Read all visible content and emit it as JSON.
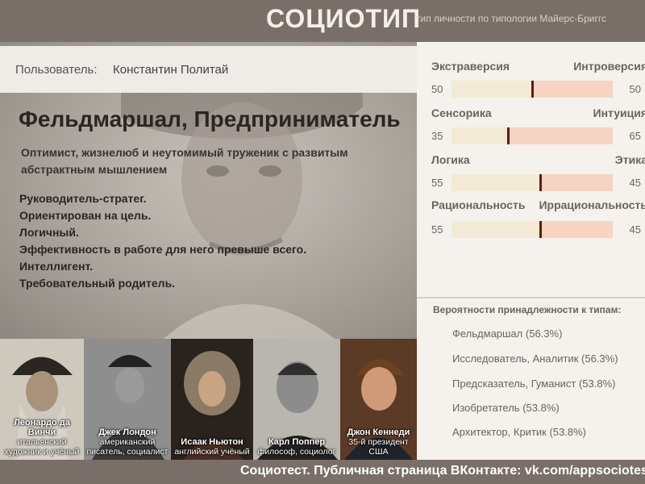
{
  "header": {
    "title": "СОЦИОТИП",
    "subtitle": "тип личности по типологии Майерс-Бриггс"
  },
  "user": {
    "label": "Пользователь:",
    "name": "Константин Политай"
  },
  "type": {
    "title": "Фельдмаршал, Предприниматель",
    "description": "Оптимист, жизнелюб и неутомимый труженик с развитым абстрактным мышлением",
    "traits": [
      "Руководитель-стратег.",
      "Ориентирован на цель.",
      "Логичный.",
      "Эффективность в работе для него превыше всего.",
      "Интеллигент.",
      "Требовательный родитель."
    ]
  },
  "scales": [
    {
      "left": "Экстраверсия",
      "right": "Интроверсия",
      "left_value": "50",
      "right_value": "50",
      "left_pct": 50
    },
    {
      "left": "Сенсорика",
      "right": "Интуиция",
      "left_value": "35",
      "right_value": "65",
      "left_pct": 35
    },
    {
      "left": "Логика",
      "right": "Этика",
      "left_value": "55",
      "right_value": "45",
      "left_pct": 55
    },
    {
      "left": "Рациональность",
      "right": "Иррациональность",
      "left_value": "55",
      "right_value": "45",
      "left_pct": 55
    }
  ],
  "probabilities": {
    "title": "Вероятности принадлежности к типам:",
    "items": [
      "Фельдмаршал (56.3%)",
      "Исследователь, Аналитик (56.3%)",
      "Предсказатель, Гуманист (53.8%)",
      "Изобретатель (53.8%)",
      "Архитектор, Критик (53.8%)"
    ]
  },
  "gallery": [
    {
      "name": "Леонардо да Винчи",
      "desc": "итальянский художник и учёный"
    },
    {
      "name": "Джек Лондон",
      "desc": "американский писатель, социалист"
    },
    {
      "name": "Исаак Ньютон",
      "desc": "английский учёный"
    },
    {
      "name": "Карл Поппер",
      "desc": "философ, социолог"
    },
    {
      "name": "Джон Кеннеди",
      "desc": "35-й президент США"
    }
  ],
  "footer": {
    "text": "Социотест. Публичная страница ВКонтакте:  vk.com/appsociotest"
  },
  "colors": {
    "header_bg": "#7a6f68",
    "bar_left": "#f3ead6",
    "bar_right": "#f7d3c2",
    "marker": "#5a1e10"
  }
}
